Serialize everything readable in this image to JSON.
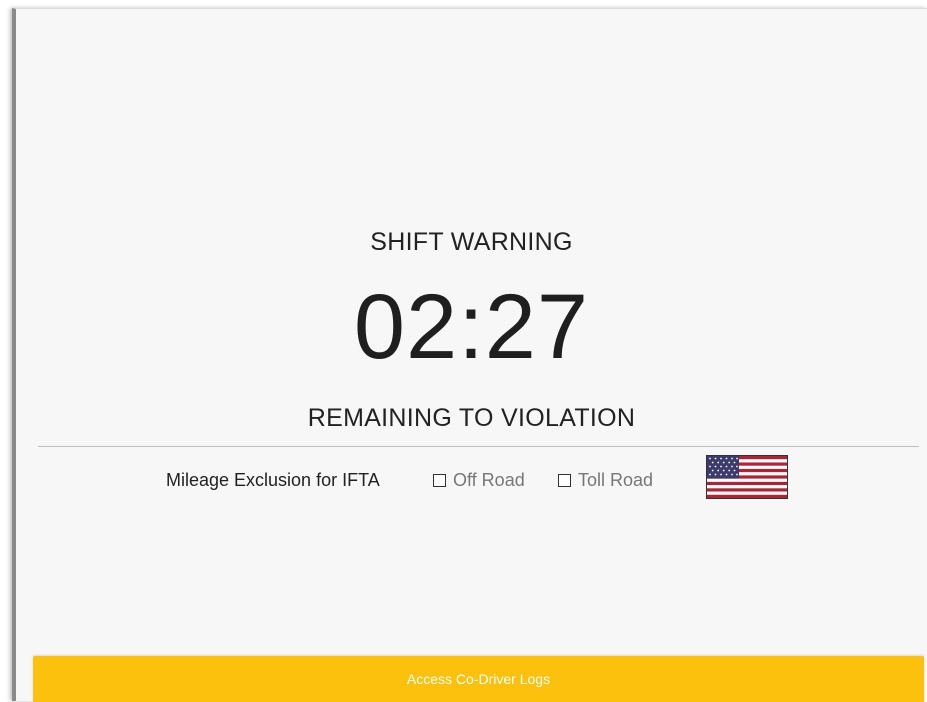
{
  "warning": {
    "title": "SHIFT WARNING",
    "timer": "02:27",
    "subtitle": "REMAINING TO VIOLATION"
  },
  "ifta": {
    "label": "Mileage Exclusion for IFTA",
    "options": [
      {
        "label": "Off Road",
        "checked": false
      },
      {
        "label": "Toll Road",
        "checked": false
      }
    ],
    "flag_icon": "us-flag-icon"
  },
  "footer": {
    "button_label": "Access Co-Driver Logs",
    "color": "#fcc10d"
  }
}
